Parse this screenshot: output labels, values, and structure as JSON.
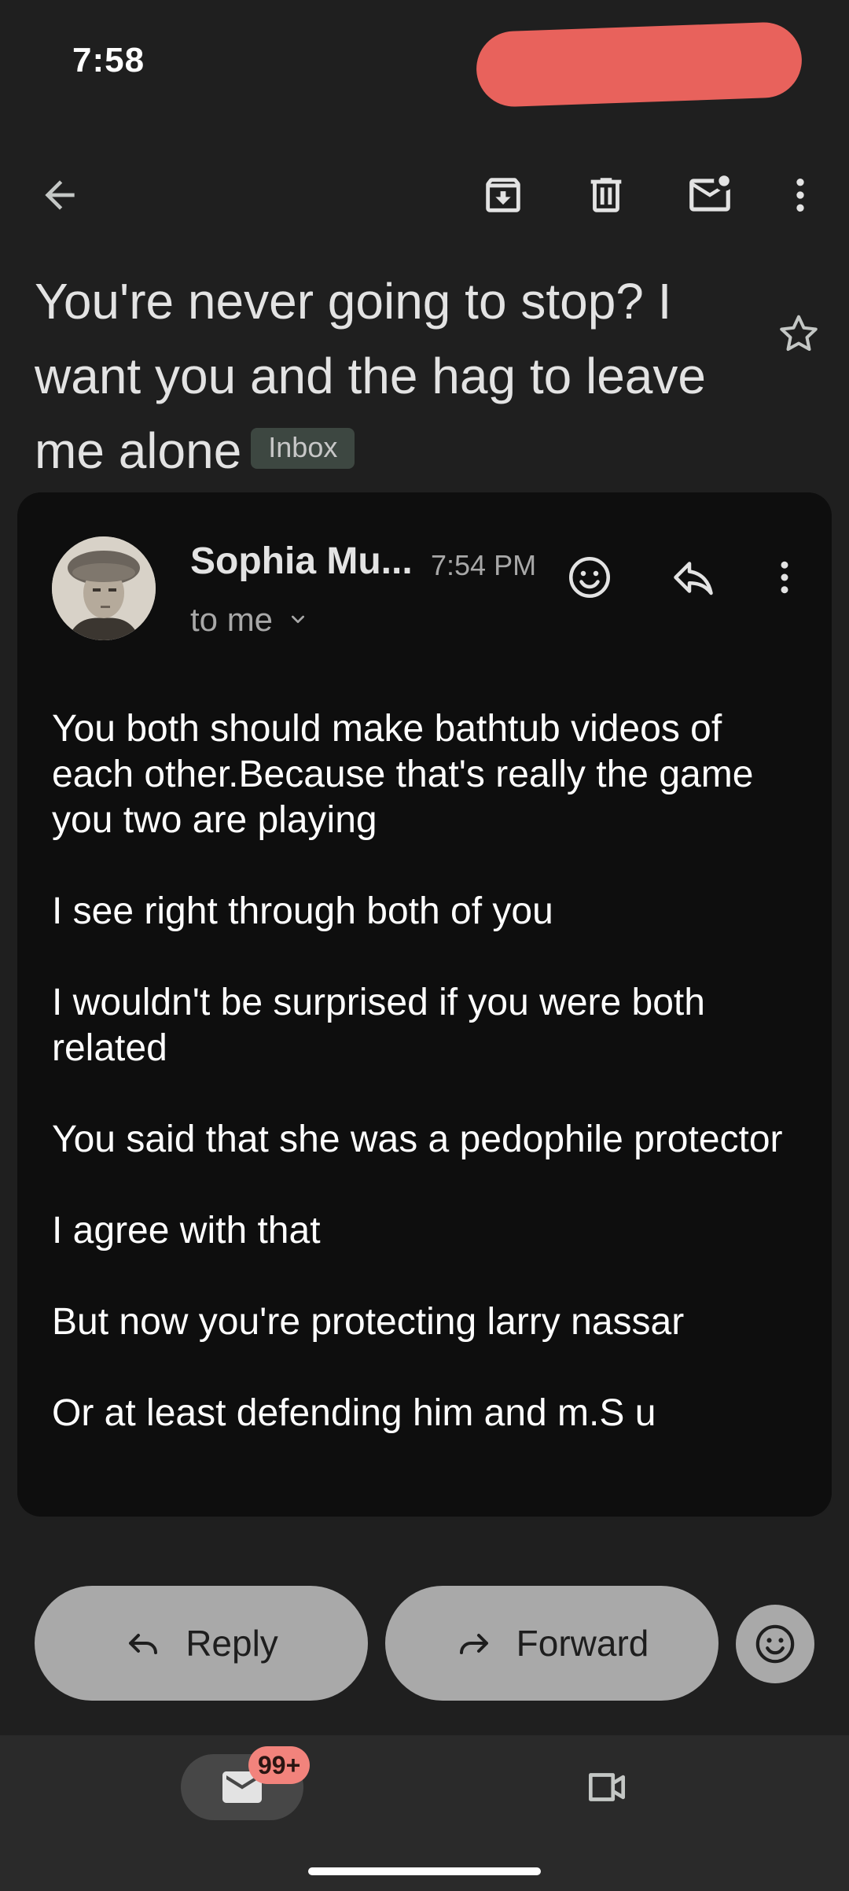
{
  "status_bar": {
    "time": "7:58"
  },
  "toolbar": {
    "back_icon": "arrow-left-icon",
    "archive_icon": "archive-icon",
    "delete_icon": "trash-icon",
    "mark_unread_icon": "mail-unread-icon",
    "more_icon": "more-vert-icon"
  },
  "subject": {
    "text": "You're never going to stop? I want you and the hag to leave me alone",
    "label": "Inbox"
  },
  "message": {
    "sender": "Sophia Mu...",
    "time": "7:54 PM",
    "recipient": "to me",
    "paragraphs": [
      "You both should make bathtub videos of each other.Because that's really the game you two are playing",
      "I see right through both of you",
      "I wouldn't be surprised if you were both related",
      "You said that she was a pedophile protector",
      "I agree with that",
      "But now you're protecting larry nassar",
      "Or at least defending him and m.S u"
    ]
  },
  "actions": {
    "reply": "Reply",
    "forward": "Forward"
  },
  "bottom_nav": {
    "mail_badge": "99+"
  },
  "colors": {
    "background": "#1f1f1f",
    "card": "#0e0e0e",
    "pill": "#a9a9a9",
    "badge": "#f2837c",
    "inbox_chip": "#3d4741"
  }
}
